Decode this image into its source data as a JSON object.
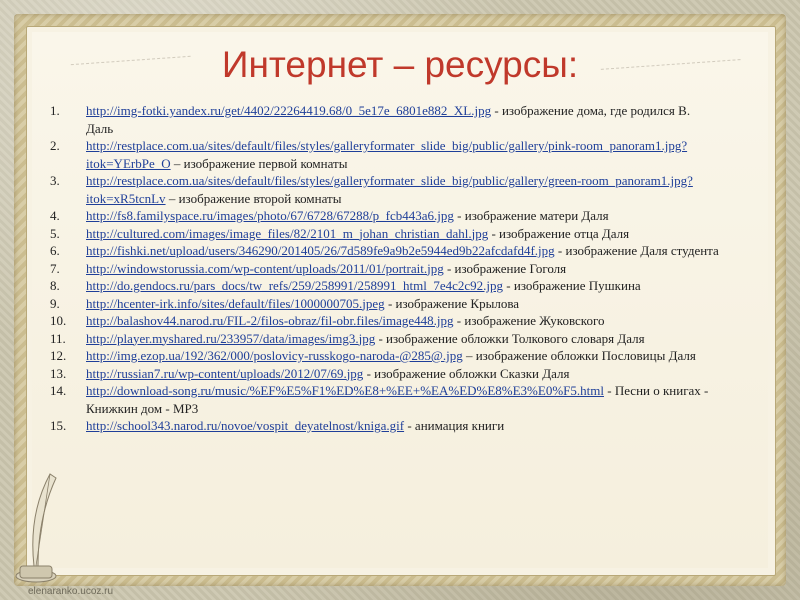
{
  "title": "Интернет – ресурсы:",
  "footer": "elenaranko.ucoz.ru",
  "items": [
    {
      "n": "1.",
      "url": "http://img-fotki.yandex.ru/get/4402/22264419.68/0_5e17e_6801e882_XL.jpg",
      "desc": " - изображение дома, где родился В. Даль"
    },
    {
      "n": "2.",
      "url": "http://restplace.com.ua/sites/default/files/styles/galleryformater_slide_big/public/gallery/pink-room_panoram1.jpg?itok=YErbPe_O",
      "desc": " – изображение первой комнаты"
    },
    {
      "n": "3.",
      "url": "http://restplace.com.ua/sites/default/files/styles/galleryformater_slide_big/public/gallery/green-room_panoram1.jpg?itok=xR5tcnLv",
      "desc": " – изображение второй комнаты"
    },
    {
      "n": "4.",
      "url": "http://fs8.familyspace.ru/images/photo/67/6728/67288/p_fcb443a6.jpg",
      "desc": " - изображение матери Даля"
    },
    {
      "n": "5.",
      "url": "http://cultured.com/images/image_files/82/2101_m_johan_christian_dahl.jpg",
      "desc": " - изображение отца Даля"
    },
    {
      "n": "6.",
      "url": "http://fishki.net/upload/users/346290/201405/26/7d589fe9a9b2e5944ed9b22afcdafd4f.jpg",
      "desc": " - изображение Даля студента"
    },
    {
      "n": "7.",
      "url": "http://windowstorussia.com/wp-content/uploads/2011/01/portrait.jpg",
      "desc": " - изображение Гоголя"
    },
    {
      "n": "8.",
      "url": "http://do.gendocs.ru/pars_docs/tw_refs/259/258991/258991_html_7e4c2c92.jpg",
      "desc": " - изображение Пушкина"
    },
    {
      "n": "9.",
      "url": "http://hcenter-irk.info/sites/default/files/1000000705.jpeg",
      "desc": " - изображение Крылова"
    },
    {
      "n": "10.",
      "url": "http://balashov44.narod.ru/FIL-2/filos-obraz/fil-obr.files/image448.jpg",
      "desc": " - изображение Жуковского"
    },
    {
      "n": "11.",
      "url": "http://player.myshared.ru/233957/data/images/img3.jpg",
      "desc": " - изображение обложки Толкового словаря Даля"
    },
    {
      "n": "12.",
      "url": "http://img.ezop.ua/192/362/000/poslovicy-russkogo-naroda-@285@.jpg",
      "desc": " – изображение обложки Пословицы Даля"
    },
    {
      "n": "13.",
      "url": "http://russian7.ru/wp-content/uploads/2012/07/69.jpg",
      "desc": "  - изображение обложки Сказки Даля"
    },
    {
      "n": "14.",
      "url": "http://download-song.ru/music/%EF%E5%F1%ED%E8+%EE+%EA%ED%E8%E3%E0%F5.html",
      "desc": " - Песни о книгах - Книжкин дом - MP3"
    },
    {
      "n": "15.",
      "url": "http://school343.narod.ru/novoe/vospit_deyatelnost/kniga.gif",
      "desc": " - анимация книги"
    }
  ]
}
